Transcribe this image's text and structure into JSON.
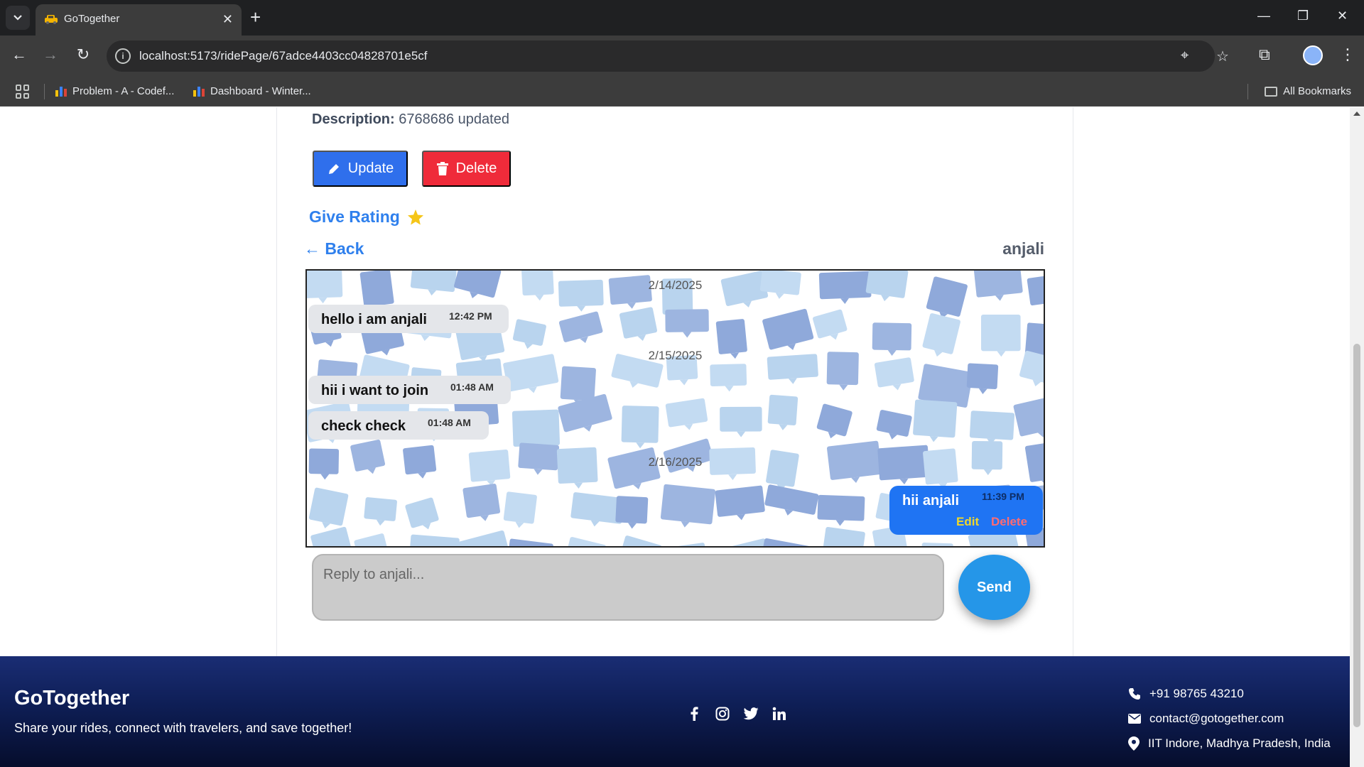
{
  "browser": {
    "tab_title": "GoTogether",
    "url": "localhost:5173/ridePage/67adce4403cc04828701e5cf",
    "bookmarks": [
      {
        "label": "Problem - A - Codef..."
      },
      {
        "label": "Dashboard - Winter..."
      }
    ],
    "all_bookmarks_label": "All Bookmarks"
  },
  "ride": {
    "description_label": "Description:",
    "description_value": "6768686 updated",
    "update_label": "Update",
    "delete_label": "Delete",
    "rating_label": "Give Rating"
  },
  "chat": {
    "back_label": "← Back",
    "partner_name": "anjali",
    "dates": [
      "2/14/2025",
      "2/15/2025",
      "2/16/2025"
    ],
    "messages": [
      {
        "text": "hello i am anjali",
        "time": "12:42 PM",
        "direction": "incoming"
      },
      {
        "text": "hii i want to join",
        "time": "01:48 AM",
        "direction": "incoming"
      },
      {
        "text": "check check",
        "time": "01:48 AM",
        "direction": "incoming"
      },
      {
        "text": "hii anjali",
        "time": "11:39 PM",
        "direction": "outgoing",
        "edit_label": "Edit",
        "delete_label": "Delete"
      }
    ],
    "reply_placeholder": "Reply to anjali...",
    "send_label": "Send"
  },
  "footer": {
    "brand": "GoTogether",
    "tagline": "Share your rides, connect with travelers, and save together!",
    "social_icons": [
      "facebook-icon",
      "instagram-icon",
      "twitter-icon",
      "linkedin-icon"
    ],
    "phone": "+91 98765 43210",
    "email": "contact@gotogether.com",
    "address": "IIT Indore, Madhya Pradesh, India"
  },
  "colors": {
    "primary_blue": "#2f80ed",
    "update_button": "#2f6fec",
    "delete_button": "#ef2b3a",
    "outgoing_bubble": "#1f74f3",
    "send_button": "#2596e8",
    "footer_top": "#1a2d74",
    "footer_bottom": "#060d2c"
  }
}
